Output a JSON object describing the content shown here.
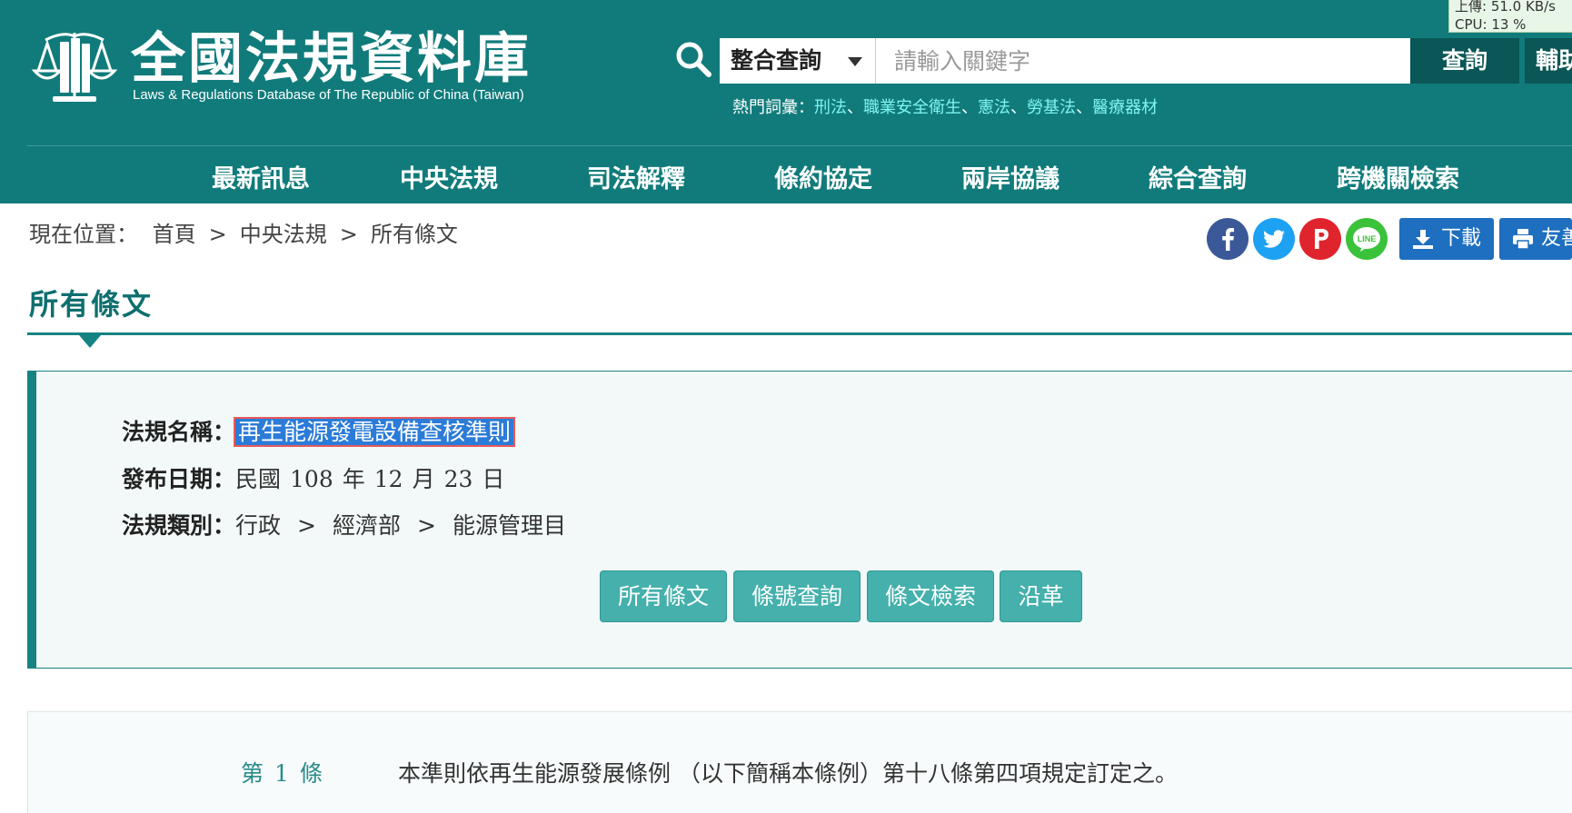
{
  "header": {
    "logo_title": "全國法規資料庫",
    "logo_subtitle": "Laws & Regulations Database of The Republic of China (Taiwan)",
    "search": {
      "scope": "整合查詢",
      "placeholder": "請輸入關鍵字",
      "button": "查詢",
      "assist_button": "輔助"
    },
    "hot_keywords": {
      "label": "熱門詞彙：",
      "items": [
        "刑法",
        "職業安全衛生",
        "憲法",
        "勞基法",
        "醫療器材"
      ],
      "separator": "、"
    }
  },
  "nav": {
    "items": [
      "最新訊息",
      "中央法規",
      "司法解釋",
      "條約協定",
      "兩岸協議",
      "綜合查詢",
      "跨機關檢索"
    ]
  },
  "monitor": {
    "line1": "上傳: 51.0 KB/s",
    "line2": "CPU: 13 %"
  },
  "breadcrumb": {
    "label": "現在位置：",
    "items": [
      "首頁",
      "中央法規",
      "所有條文"
    ],
    "separator": ">"
  },
  "share": {
    "icons": [
      "facebook-icon",
      "twitter-icon",
      "pinterest-icon",
      "line-icon"
    ],
    "line_label": "LINE",
    "download": "下載",
    "print": "友善"
  },
  "colors": {
    "header_bg": "#117b7b",
    "accent": "#168383",
    "action_btn": "#45b0ac",
    "hot_keyword": "#7ff4f0",
    "tool_btn": "#1e6fbf",
    "facebook": "#3b5998",
    "twitter": "#1da1f2",
    "pinterest": "#e0242d",
    "line": "#3ac33a"
  },
  "page_title": "所有條文",
  "law_info": {
    "name_label": "法規名稱：",
    "name": "再生能源發電設備查核準則",
    "date_label": "發布日期：",
    "date": {
      "era": "民國",
      "year": "108",
      "year_unit": "年",
      "month": "12",
      "month_unit": "月",
      "day": "23",
      "day_unit": "日"
    },
    "category_label": "法規類別：",
    "category": [
      "行政",
      "經濟部",
      "能源管理目"
    ],
    "category_separator": ">"
  },
  "actions": [
    "所有條文",
    "條號查詢",
    "條文檢索",
    "沿革"
  ],
  "articles": [
    {
      "prefix": "第",
      "number": "1",
      "suffix": "條",
      "text": "本準則依再生能源發展條例 （以下簡稱本條例）第十八條第四項規定訂定之。"
    }
  ]
}
